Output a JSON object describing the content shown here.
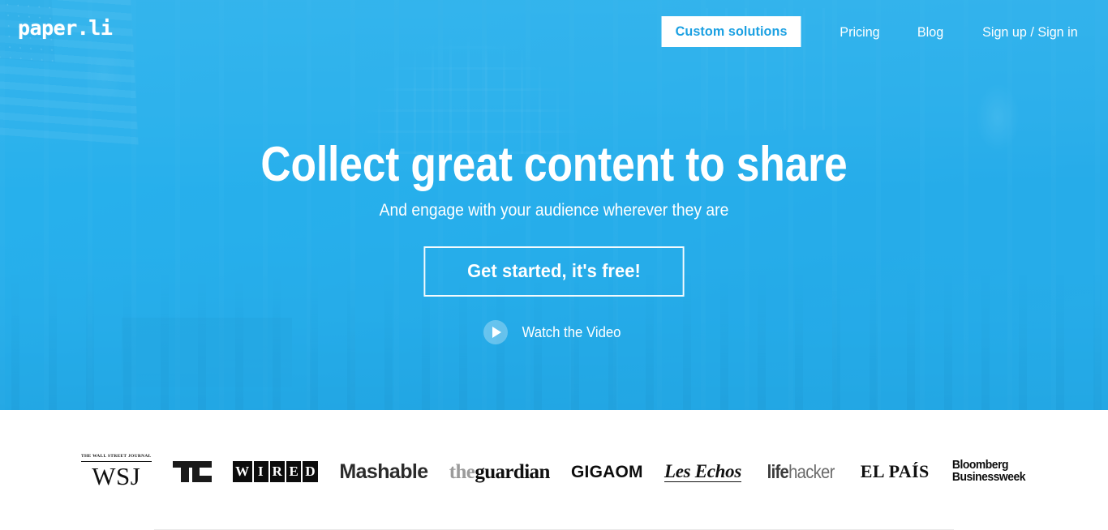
{
  "brand": {
    "logo_text": "paper.li"
  },
  "nav": {
    "cta_button": "Custom solutions",
    "links": [
      {
        "label": "Pricing"
      },
      {
        "label": "Blog"
      },
      {
        "label": "Sign up / Sign in"
      }
    ]
  },
  "hero": {
    "headline": "Collect great content to share",
    "subheadline": "And engage with your audience wherever they are",
    "cta_label": "Get started, it's free!",
    "video_label": "Watch the Video",
    "play_icon": "play-icon",
    "background_image": "grand-central-terminal-crowd-photo",
    "overlay_color": "#29ade8"
  },
  "press": {
    "logos": [
      {
        "name": "wsj",
        "kicker": "THE WALL STREET JOURNAL",
        "mark": "WSJ"
      },
      {
        "name": "techcrunch",
        "mark": "TC"
      },
      {
        "name": "wired",
        "letters": [
          "W",
          "I",
          "R",
          "E",
          "D"
        ]
      },
      {
        "name": "mashable",
        "mark": "Mashable"
      },
      {
        "name": "the-guardian",
        "the": "the",
        "guardian": "guardian"
      },
      {
        "name": "gigaom",
        "mark": "GIGAOM"
      },
      {
        "name": "les-echos",
        "mark": "Les Echos"
      },
      {
        "name": "lifehacker",
        "life": "life",
        "hacker": "hacker"
      },
      {
        "name": "el-pais",
        "mark": "EL PAÍS"
      },
      {
        "name": "bloomberg-businessweek",
        "line1": "Bloomberg",
        "line2": "Businessweek"
      }
    ]
  },
  "colors": {
    "brand_blue": "#29ade8",
    "brand_blue_text": "#1ba0e2",
    "white": "#ffffff",
    "divider": "#e9e9e9"
  }
}
